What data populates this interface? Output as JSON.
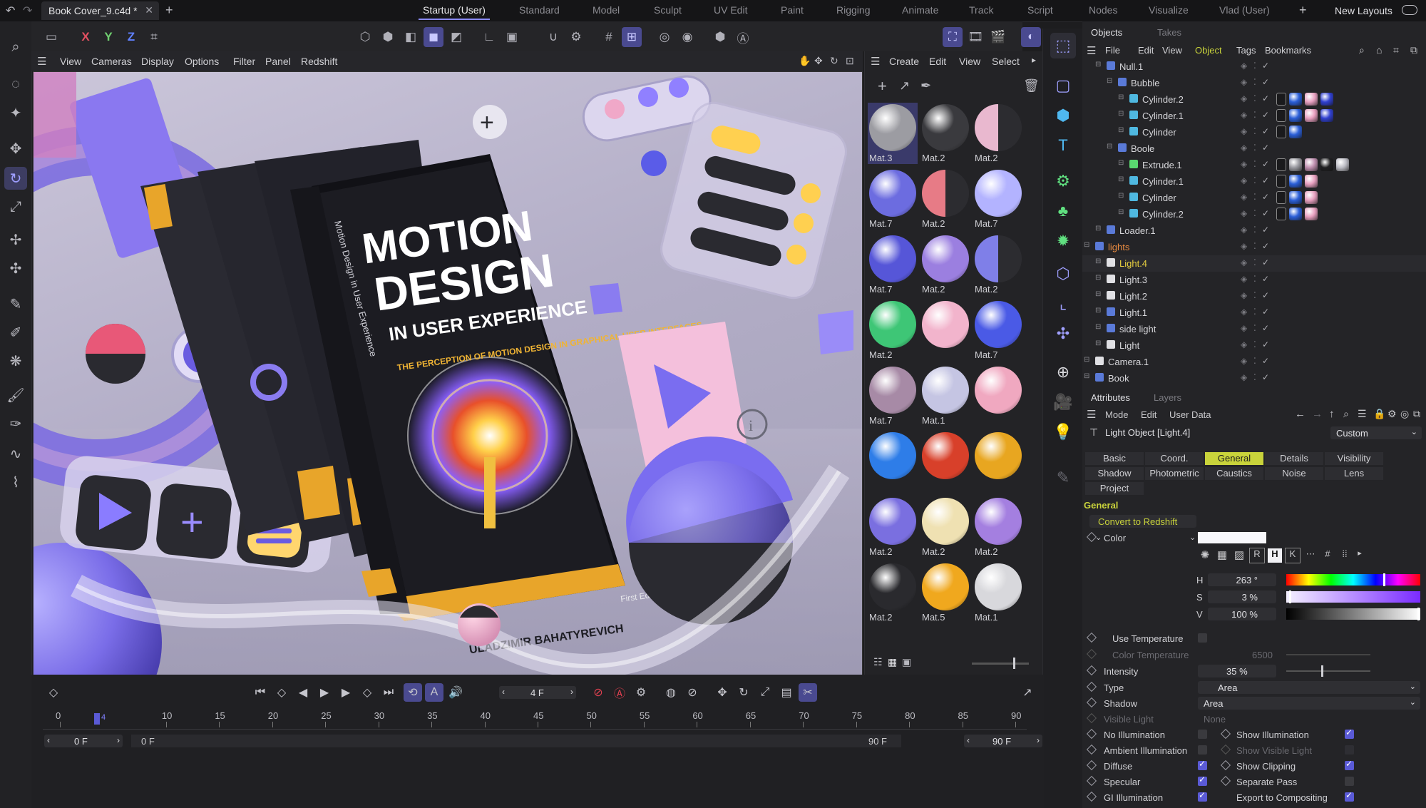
{
  "titlebar": {
    "doc_title": "Book Cover_9.c4d *",
    "layouts": [
      "Startup (User)",
      "Standard",
      "Model",
      "Sculpt",
      "UV Edit",
      "Paint",
      "Rigging",
      "Animate",
      "Track",
      "Script",
      "Nodes",
      "Visualize",
      "Vlad (User)"
    ],
    "active_layout": "Startup (User)",
    "new_layouts": "New Layouts"
  },
  "toolbar": {
    "axis_x": "X",
    "axis_y": "Y",
    "axis_z": "Z"
  },
  "viewport_menu": [
    "View",
    "Cameras",
    "Display",
    "Options",
    "Filter",
    "Panel",
    "Redshift"
  ],
  "scene": {
    "book_title_1": "MOTION",
    "book_title_2": "DESIGN",
    "book_title_3": "IN USER EXPERIENCE",
    "book_subtitle": "THE PERCEPTION OF MOTION DESIGN IN GRAPHICAL USER INTERFACES",
    "book_author": "ULADZIMIR BAHATYREVICH",
    "book_edition": "First Edition",
    "spine_text": "Motion Design in User Experience"
  },
  "materials": {
    "menu": [
      "Create",
      "Edit",
      "View",
      "Select"
    ],
    "items": [
      {
        "label": "Mat.3",
        "color": "#9c9ca2",
        "sel": true
      },
      {
        "label": "Mat.2",
        "color": "#3a3a3e"
      },
      {
        "label": "Mat.2",
        "color": "#e9b8cf",
        "half": "#2c2c30"
      },
      {
        "label": "Mat.7",
        "color": "#6c6ce0"
      },
      {
        "label": "Mat.2",
        "color": "#e77b86",
        "half": "#2c2c30"
      },
      {
        "label": "Mat.7",
        "color": "#b3b3ff"
      },
      {
        "label": "Mat.7",
        "color": "#5656d8"
      },
      {
        "label": "Mat.2",
        "color": "#9b7fe0"
      },
      {
        "label": "Mat.2",
        "color": "#7f7fe8",
        "half": "#2c2c30"
      },
      {
        "label": "Mat.2",
        "color": "#3ec676"
      },
      {
        "label": "",
        "color": "#f2b4cc"
      },
      {
        "label": "Mat.7",
        "color": "#4a5ae6"
      },
      {
        "label": "Mat.7",
        "color": "#a78aa6"
      },
      {
        "label": "Mat.1",
        "color": "#c5c5e3"
      },
      {
        "label": "",
        "color": "#f0a8c0"
      },
      {
        "label": "",
        "color": "#2e7de8"
      },
      {
        "label": "",
        "color": "#d8402a"
      },
      {
        "label": "",
        "color": "#e8a620"
      },
      {
        "label": "Mat.2",
        "color": "#7a6fe0"
      },
      {
        "label": "Mat.2",
        "color": "#efe1b2"
      },
      {
        "label": "Mat.2",
        "color": "#a47fe0"
      },
      {
        "label": "Mat.2",
        "color": "#2a2a2e"
      },
      {
        "label": "Mat.5",
        "color": "#f0a81e"
      },
      {
        "label": "Mat.1",
        "color": "#d8d8dc"
      }
    ]
  },
  "objects": {
    "tabs": [
      "Objects",
      "Takes"
    ],
    "menu": [
      "File",
      "Edit",
      "View",
      "Object",
      "Tags",
      "Bookmarks"
    ],
    "active_menu": "Object",
    "rows": [
      {
        "name": "Null.1",
        "indent": 1,
        "icon": "#5a7ad8",
        "highlight": false
      },
      {
        "name": "Bubble",
        "indent": 2,
        "icon": "#5a7ad8"
      },
      {
        "name": "Cylinder.2",
        "indent": 3,
        "icon": "#4fb8e0",
        "tags": [
          "#2b5fd8",
          "#e8a0c0",
          "#3040d0"
        ]
      },
      {
        "name": "Cylinder.1",
        "indent": 3,
        "icon": "#4fb8e0",
        "tags": [
          "#2b5fd8",
          "#e8a0c0",
          "#3040d0"
        ]
      },
      {
        "name": "Cylinder",
        "indent": 3,
        "icon": "#4fb8e0",
        "tags": [
          "#2b5fd8"
        ]
      },
      {
        "name": "Boole",
        "indent": 2,
        "icon": "#5a7ad8"
      },
      {
        "name": "Extrude.1",
        "indent": 3,
        "icon": "#5ad870",
        "tags": [
          "#9a9aa0",
          "#c090b0",
          "#202022",
          "#bcbcc4"
        ]
      },
      {
        "name": "Cylinder.1",
        "indent": 3,
        "icon": "#4fb8e0",
        "tags": [
          "#2b5fd8",
          "#e8a0c0"
        ]
      },
      {
        "name": "Cylinder",
        "indent": 3,
        "icon": "#4fb8e0",
        "tags": [
          "#2b5fd8",
          "#e8a0c0"
        ]
      },
      {
        "name": "Cylinder.2",
        "indent": 3,
        "icon": "#4fb8e0",
        "tags": [
          "#2b5fd8",
          "#e8a0c0"
        ]
      },
      {
        "name": "Loader.1",
        "indent": 1,
        "icon": "#5a7ad8"
      },
      {
        "name": "lights",
        "indent": 0,
        "icon": "#5a7ad8",
        "orange": true
      },
      {
        "name": "Light.4",
        "indent": 1,
        "icon": "#e0e0e4",
        "yellow": true
      },
      {
        "name": "Light.3",
        "indent": 1,
        "icon": "#e0e0e4"
      },
      {
        "name": "Light.2",
        "indent": 1,
        "icon": "#e0e0e4"
      },
      {
        "name": "Light.1",
        "indent": 1,
        "icon": "#5a7ad8"
      },
      {
        "name": "side light",
        "indent": 1,
        "icon": "#5a7ad8"
      },
      {
        "name": "Light",
        "indent": 1,
        "icon": "#e0e0e4"
      },
      {
        "name": "Camera.1",
        "indent": 0,
        "icon": "#e0e0e4"
      },
      {
        "name": "Book",
        "indent": 0,
        "icon": "#5a7ad8"
      }
    ]
  },
  "attributes": {
    "tabs": [
      "Attributes",
      "Layers"
    ],
    "menu": [
      "Mode",
      "Edit",
      "User Data"
    ],
    "object_title": "Light Object [Light.4]",
    "preset": "Custom",
    "section_tabs": [
      "Basic",
      "Coord.",
      "General",
      "Details",
      "Visibility",
      "Shadow",
      "Photometric",
      "Caustics",
      "Noise",
      "Lens",
      "Project"
    ],
    "active_section": "General",
    "section_title": "General",
    "convert_btn": "Convert to Redshift",
    "color_label": "Color",
    "h_label": "H",
    "h_value": "263 °",
    "s_label": "S",
    "s_value": "3 %",
    "v_label": "V",
    "v_value": "100 %",
    "use_temp": "Use Temperature",
    "color_temp": "Color Temperature",
    "color_temp_value": "6500",
    "intensity": "Intensity",
    "intensity_value": "35 %",
    "intensity_level": 0.35,
    "type": "Type",
    "type_value": "Area",
    "shadow": "Shadow",
    "shadow_value": "Area",
    "visible_light": "Visible Light",
    "visible_light_value": "None",
    "no_illum": "No Illumination",
    "ambient_illum": "Ambient Illumination",
    "diffuse": "Diffuse",
    "specular": "Specular",
    "gi_illum": "GI Illumination",
    "show_illum": "Show Illumination",
    "show_visible": "Show Visible Light",
    "show_clipping": "Show Clipping",
    "separate_pass": "Separate Pass",
    "export_comp": "Export to Compositing"
  },
  "timeline": {
    "current_frame": "4 F",
    "start_frame": "0 F",
    "start_frame2": "0 F",
    "end_frame": "90 F",
    "end_frame2": "90 F",
    "ticks": [
      "0",
      "10",
      "15",
      "20",
      "25",
      "30",
      "35",
      "40",
      "45",
      "50",
      "55",
      "60",
      "65",
      "70",
      "75",
      "80",
      "85",
      "90"
    ],
    "playhead_label": "4"
  }
}
